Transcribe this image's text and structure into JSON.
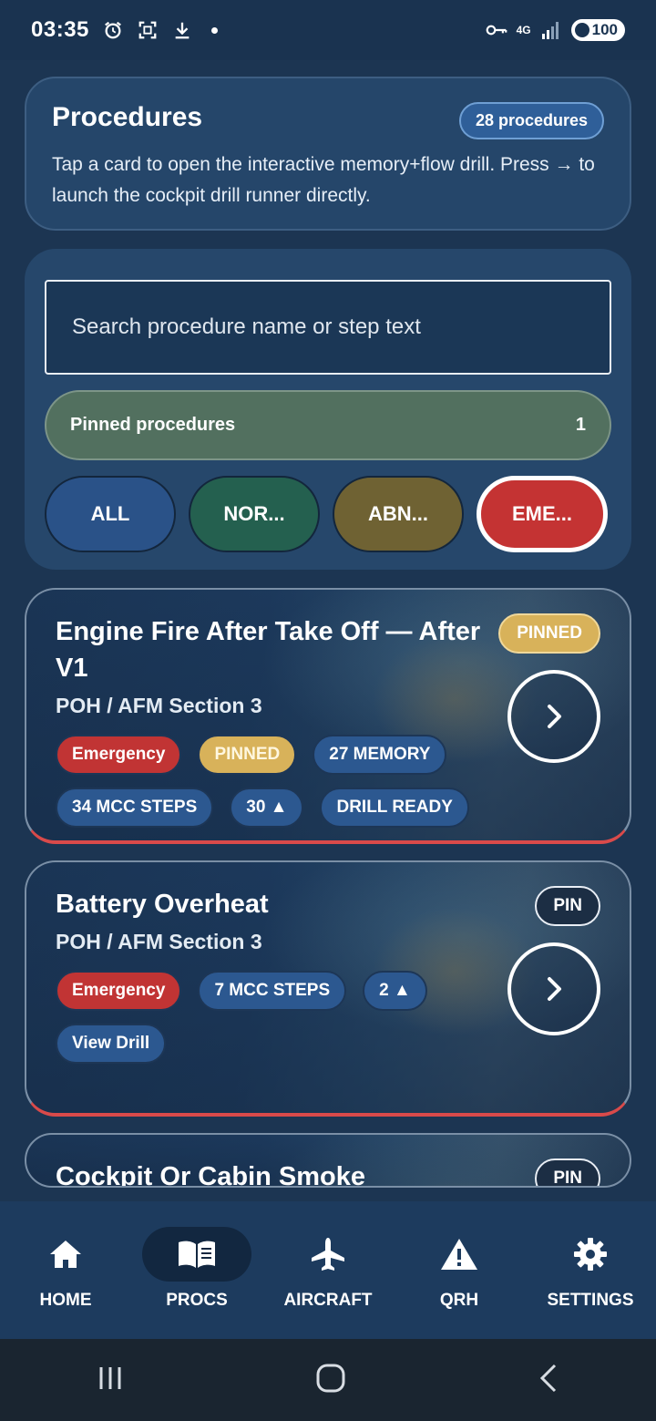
{
  "status_bar": {
    "time": "03:35",
    "network": "4G",
    "battery": "100"
  },
  "header": {
    "title": "Procedures",
    "count_badge": "28 procedures",
    "description": "Tap a card to open the interactive memory+flow drill. Press → to launch the cockpit drill runner directly."
  },
  "filters": {
    "search_placeholder": "Search procedure name or step text",
    "pinned_label": "Pinned procedures",
    "pinned_count": "1",
    "chips": [
      {
        "label": "ALL",
        "color": "#2a5288"
      },
      {
        "label": "NOR...",
        "color": "#24604f"
      },
      {
        "label": "ABN...",
        "color": "#6f6233"
      },
      {
        "label": "EME...",
        "color": "#c43333",
        "selected": true
      }
    ]
  },
  "procedures": [
    {
      "title": "Engine Fire After Take Off — After V1",
      "source": "POH / AFM Section 3",
      "pin_label": "PINNED",
      "tags": [
        "Emergency",
        "PINNED",
        "27 MEMORY",
        "34 MCC STEPS",
        "30 ▲",
        "DRILL READY"
      ]
    },
    {
      "title": "Battery Overheat",
      "source": "POH / AFM Section 3",
      "pin_label": "PIN",
      "tags": [
        "Emergency",
        "7 MCC STEPS",
        "2 ▲",
        "View Drill"
      ]
    },
    {
      "title": "Cockpit Or Cabin Smoke",
      "pin_label": "PIN"
    }
  ],
  "bottom_nav": [
    {
      "label": "HOME",
      "icon": "home-icon"
    },
    {
      "label": "PROCS",
      "icon": "book-icon",
      "active": true
    },
    {
      "label": "AIRCRAFT",
      "icon": "airplane-icon"
    },
    {
      "label": "QRH",
      "icon": "warning-icon"
    },
    {
      "label": "SETTINGS",
      "icon": "gear-icon"
    }
  ]
}
